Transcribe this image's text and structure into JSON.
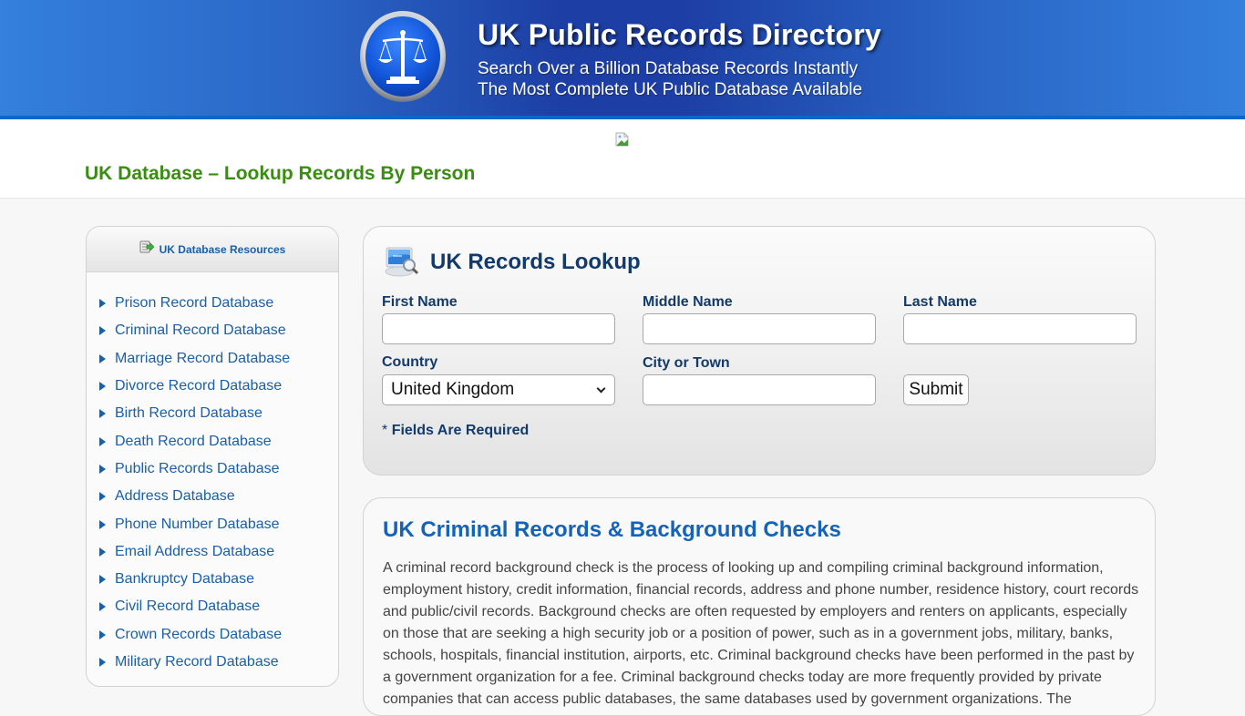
{
  "header": {
    "title": "UK Public Records Directory",
    "subtitle_line1": "Search Over a Billion Database Records Instantly",
    "subtitle_line2": "The Most Complete UK Public Database Available",
    "logo_icon": "scales-of-justice-icon"
  },
  "page": {
    "heading": "UK Database – Lookup Records By Person",
    "broken_image_icon": "broken-image-icon"
  },
  "sidebar": {
    "title": "UK Database Resources",
    "items": [
      {
        "label": "Prison Record Database"
      },
      {
        "label": "Criminal Record Database"
      },
      {
        "label": "Marriage Record Database"
      },
      {
        "label": "Divorce Record Database"
      },
      {
        "label": "Birth Record Database"
      },
      {
        "label": "Death Record Database"
      },
      {
        "label": "Public Records Database"
      },
      {
        "label": "Address Database"
      },
      {
        "label": "Phone Number Database"
      },
      {
        "label": "Email Address Database"
      },
      {
        "label": "Bankruptcy Database"
      },
      {
        "label": "Civil Record Database"
      },
      {
        "label": "Crown Records Database"
      },
      {
        "label": "Military Record Database"
      }
    ]
  },
  "search_form": {
    "title": "UK Records Lookup",
    "fields": {
      "first_name": {
        "label": "First Name",
        "value": ""
      },
      "middle_name": {
        "label": "Middle Name",
        "value": ""
      },
      "last_name": {
        "label": "Last Name",
        "value": ""
      },
      "country": {
        "label": "Country",
        "selected": "United Kingdom"
      },
      "city": {
        "label": "City or Town",
        "value": ""
      }
    },
    "submit_label": "Submit",
    "required_note_star": "*",
    "required_note": "Fields Are Required"
  },
  "article": {
    "title": "UK Criminal Records & Background Checks",
    "body": "A criminal record background check is the process of looking up and compiling criminal background information, employment history, credit information,  financial records, address and phone number, residence history, court records and public/civil records. Background checks are often requested by employers and renters on applicants, especially on those that are seeking a high security job or a position of power, such as in a government jobs, military, banks, schools, hospitals, financial institution, airports, etc. Criminal background checks have been performed in the past by a government organization for a fee. Criminal background checks today are more frequently provided by private companies that can access public databases, the same databases used by government organizations. The"
  },
  "colors": {
    "banner_blue": "#1d3fa5",
    "heading_green": "#3a8c12",
    "link_blue": "#1a5fa8",
    "label_navy": "#123a6b",
    "article_title_blue": "#1463b8"
  }
}
